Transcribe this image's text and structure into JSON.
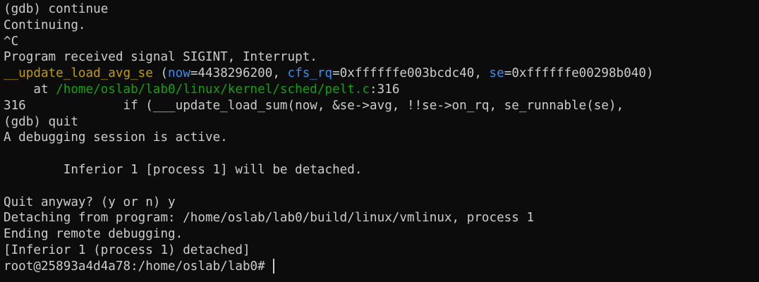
{
  "terminal": {
    "colors": {
      "background": "#0c0c0c",
      "text": "#cccccc",
      "function_name": "#c19c00",
      "argument_name": "#3b8eea",
      "file_path": "#13a10e"
    },
    "lines": [
      {
        "text": "(gdb) continue"
      },
      {
        "text": "Continuing."
      },
      {
        "text": "^C"
      },
      {
        "text": "Program received signal SIGINT, Interrupt."
      },
      {
        "frame": {
          "function": "__update_load_avg_se",
          "open_paren": " (",
          "arg1_name": "now",
          "arg1_value": "=4438296200, ",
          "arg2_name": "cfs_rq",
          "arg2_value": "=0xffffffe003bcdc40, ",
          "arg3_name": "se",
          "arg3_value": "=0xffffffe00298b040)"
        }
      },
      {
        "location": {
          "prefix": "    at ",
          "path": "/home/oslab/lab0/linux/kernel/sched/pelt.c",
          "line_suffix": ":316"
        }
      },
      {
        "text": "316             if (___update_load_sum(now, &se->avg, !!se->on_rq, se_runnable(se),"
      },
      {
        "text": "(gdb) quit"
      },
      {
        "text": "A debugging session is active."
      },
      {
        "text": ""
      },
      {
        "text": "        Inferior 1 [process 1] will be detached."
      },
      {
        "text": ""
      },
      {
        "text": "Quit anyway? (y or n) y"
      },
      {
        "text": "Detaching from program: /home/oslab/lab0/build/linux/vmlinux, process 1"
      },
      {
        "text": "Ending remote debugging."
      },
      {
        "text": "[Inferior 1 (process 1) detached]"
      },
      {
        "text": "root@25893a4d4a78:/home/oslab/lab0# "
      }
    ]
  }
}
